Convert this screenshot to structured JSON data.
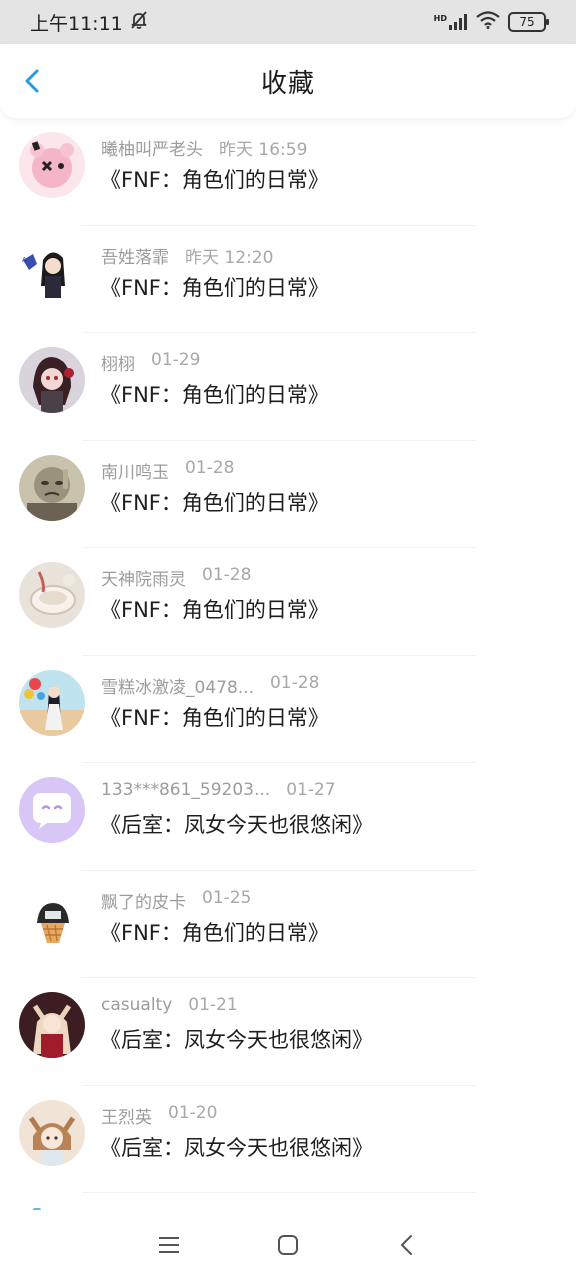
{
  "status_bar": {
    "time": "上午11:11",
    "network_label": "HD",
    "battery": "75",
    "icons": [
      "mute-bell-icon",
      "signal-icon",
      "wifi-icon",
      "battery-icon"
    ]
  },
  "header": {
    "title": "收藏",
    "back_icon": "chevron-left-icon",
    "accent_color": "#2a9be0"
  },
  "items": [
    {
      "user": "曦柚叫严老头",
      "time": "昨天 16:59",
      "work": "《FNF：角色们的日常》"
    },
    {
      "user": "吾姓落霏",
      "time": "昨天 12:20",
      "work": "《FNF：角色们的日常》"
    },
    {
      "user": "栩栩",
      "time": "01-29",
      "work": "《FNF：角色们的日常》"
    },
    {
      "user": "南川鸣玉",
      "time": "01-28",
      "work": "《FNF：角色们的日常》"
    },
    {
      "user": "天神院雨灵",
      "time": "01-28",
      "work": "《FNF：角色们的日常》"
    },
    {
      "user": "雪糕冰激凌_0478...",
      "time": "01-28",
      "work": "《FNF：角色们的日常》"
    },
    {
      "user": "133***861_59203...",
      "time": "01-27",
      "work": "《后室：凤女今天也很悠闲》"
    },
    {
      "user": "飘了的皮卡",
      "time": "01-25",
      "work": "《FNF：角色们的日常》"
    },
    {
      "user": "casualty",
      "time": "01-21",
      "work": "《后室：凤女今天也很悠闲》"
    },
    {
      "user": "王烈英",
      "time": "01-20",
      "work": "《后室：凤女今天也很悠闲》"
    }
  ],
  "bottom_nav": {
    "icons": [
      "menu-icon",
      "home-square-icon",
      "back-triangle-icon"
    ]
  }
}
